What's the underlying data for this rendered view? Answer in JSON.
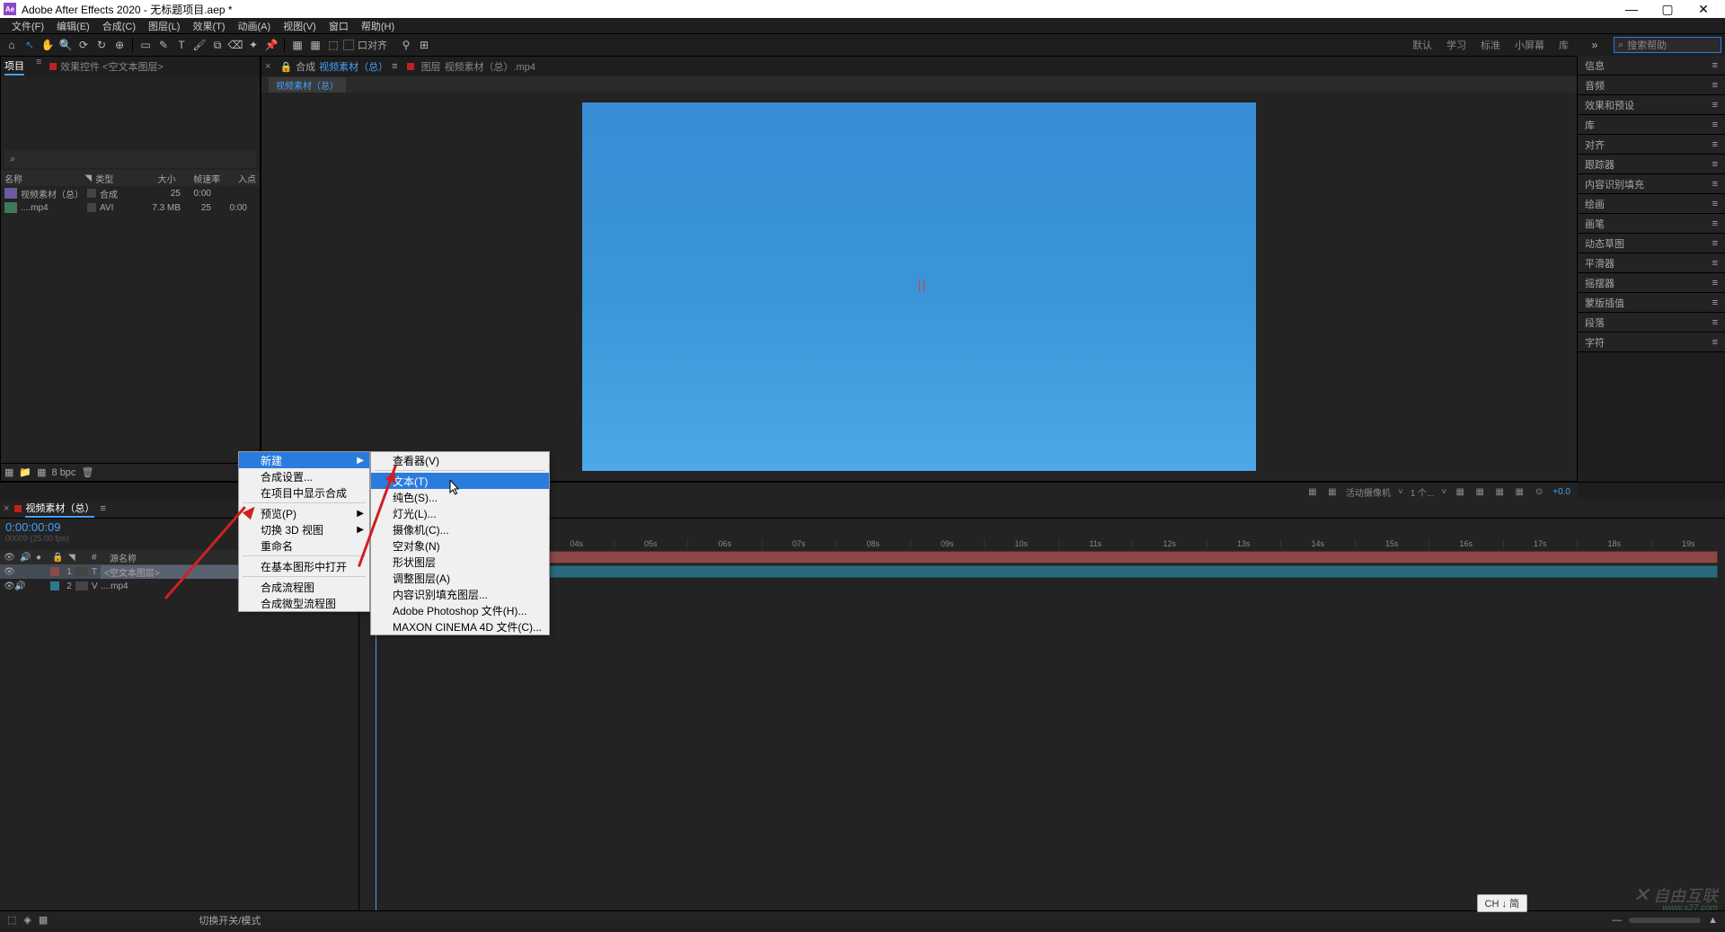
{
  "titlebar": {
    "app": "Adobe After Effects 2020",
    "doc": "无标题项目.aep *"
  },
  "menubar": [
    "文件(F)",
    "编辑(E)",
    "合成(C)",
    "图层(L)",
    "效果(T)",
    "动画(A)",
    "视图(V)",
    "窗口",
    "帮助(H)"
  ],
  "toolbar": {
    "snap": "口对齐",
    "workspaces": [
      "默认",
      "学习",
      "标准",
      "小屏幕",
      "库"
    ],
    "search_ph": "搜索帮助"
  },
  "project_panel": {
    "tab1": "项目",
    "tab2": "效果控件 <空文本图层>",
    "search_icon": "⌕",
    "headers": {
      "name": "名称",
      "type": "类型",
      "size": "大小",
      "fps": "帧速率",
      "in": "入点"
    },
    "rows": [
      {
        "name": "视频素材（总）",
        "type": "合成",
        "size": "25",
        "fps": "0:00"
      },
      {
        "name": "....mp4",
        "type": "AVI",
        "size": "7.3 MB",
        "fps": "25",
        "in": "0:00"
      }
    ],
    "footer_bpc": "8 bpc"
  },
  "comp_panel": {
    "tab_prefix": "合成",
    "tab_name": "视频素材（总）",
    "layer_tab_prefix": "图层",
    "layer_tab": "视频素材（总）.mp4",
    "crumb": "视频素材（总）"
  },
  "viewer_footer": {
    "camera": "活动摄像机",
    "views": "1 个...",
    "offset": "+0.0"
  },
  "right_panels": [
    "信息",
    "音频",
    "效果和预设",
    "库",
    "对齐",
    "跟踪器",
    "内容识别填充",
    "绘画",
    "画笔",
    "动态草图",
    "平滑器",
    "摇摆器",
    "蒙版插值",
    "段落",
    "字符"
  ],
  "timeline": {
    "tab": "视频素材（总）",
    "timecode": "0:00:00:09",
    "frames": "00009 (25.00 fps)",
    "search": "⌕",
    "col_source": "源名称",
    "layers": [
      {
        "num": "1",
        "name": "<空文本图层>",
        "color": "#8c4848",
        "selected": true,
        "type": "T"
      },
      {
        "num": "2",
        "name": "....mp4",
        "color": "#2a7a8c",
        "selected": false,
        "type": "V"
      }
    ],
    "ticks": [
      "04s",
      "05s",
      "06s",
      "07s",
      "08s",
      "09s",
      "10s",
      "11s",
      "12s",
      "13s",
      "14s",
      "15s",
      "16s",
      "17s",
      "18s",
      "19s"
    ],
    "footer": "切换开关/模式"
  },
  "ctx1": {
    "items": [
      {
        "t": "新建",
        "sub": true,
        "hl": true
      },
      {
        "t": "合成设置..."
      },
      {
        "t": "在项目中显示合成"
      },
      {
        "sep": true
      },
      {
        "t": "预览(P)",
        "sub": true
      },
      {
        "t": "切换 3D 视图",
        "sub": true
      },
      {
        "t": "重命名"
      },
      {
        "sep": true
      },
      {
        "t": "在基本图形中打开"
      },
      {
        "sep": true
      },
      {
        "t": "合成流程图"
      },
      {
        "t": "合成微型流程图"
      }
    ]
  },
  "ctx2": {
    "items": [
      {
        "t": "查看器(V)"
      },
      {
        "sep": true
      },
      {
        "t": "文本(T)",
        "hl": true
      },
      {
        "t": "纯色(S)..."
      },
      {
        "t": "灯光(L)..."
      },
      {
        "t": "摄像机(C)..."
      },
      {
        "t": "空对象(N)"
      },
      {
        "t": "形状图层"
      },
      {
        "t": "调整图层(A)"
      },
      {
        "t": "内容识别填充图层..."
      },
      {
        "t": "Adobe Photoshop 文件(H)..."
      },
      {
        "t": "MAXON CINEMA 4D 文件(C)..."
      }
    ]
  },
  "ime": "CH ↓ 简",
  "watermark": "自由互联",
  "watermark_sub": "www.x27.com"
}
